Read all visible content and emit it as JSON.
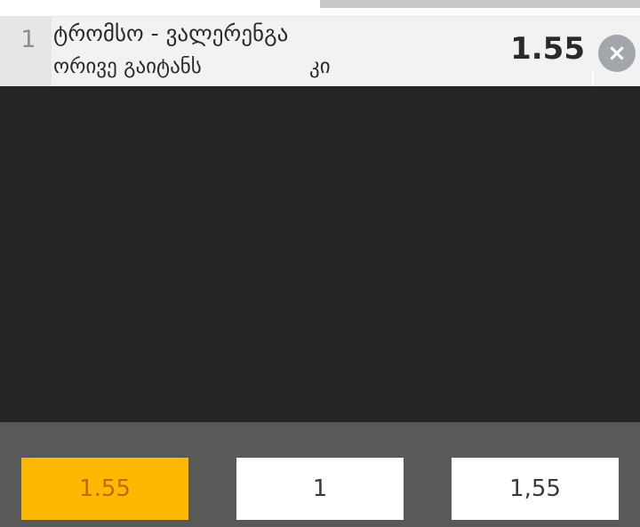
{
  "bet": {
    "index": "1",
    "match": "ტრომსო - ვალერენგა",
    "market": "ორივე გაიტანს",
    "outcome": "კი",
    "odds": "1.55",
    "remove_icon": "×"
  },
  "quick_values": {
    "option1": "1.55",
    "option2": "1",
    "option3": "1,55"
  },
  "colors": {
    "selected_bg": "#fcb900",
    "selected_text": "#c26a08",
    "remove_button": "#a3a7ab",
    "background_dark": "#252525",
    "quick_bar_bg": "#595959"
  }
}
